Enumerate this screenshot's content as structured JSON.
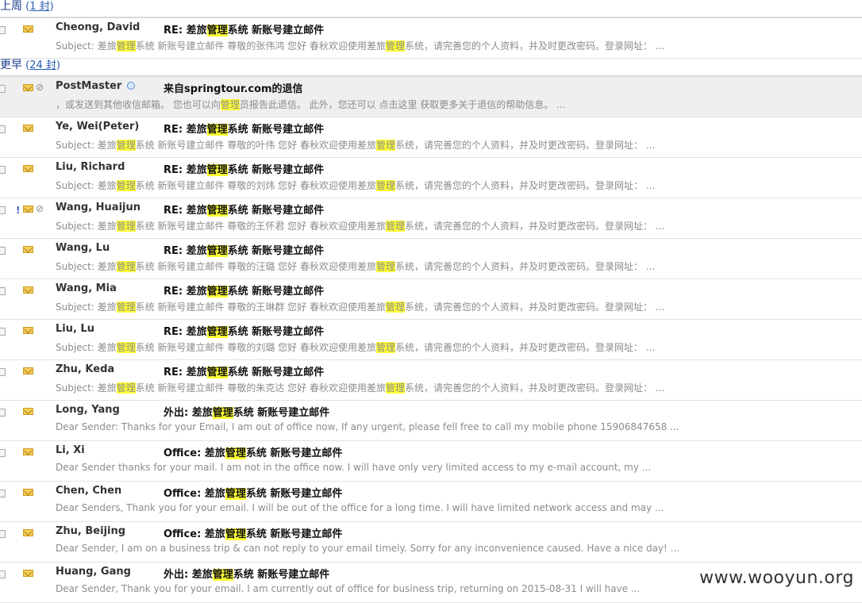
{
  "colors": {
    "highlight": "#ffff33",
    "link": "#2a5db0",
    "group": "#1a3f8b"
  },
  "groups": [
    {
      "label": "上周",
      "count_label": "1 封",
      "rows": [
        {
          "sender": "Cheong, David",
          "subject": "RE: 差旅|管理|系统 新账号建立邮件",
          "preview": "Subject: 差旅|管理|系统 新账号建立邮件 尊敬的张伟鸿 您好 春秋欢迎使用差旅|管理|系统，请完善您的个人资料，并及时更改密码。登录网址： ...",
          "icons": [
            "envelope-icon"
          ],
          "selected": false
        }
      ]
    },
    {
      "label": "更早",
      "count_label": "24 封",
      "rows": [
        {
          "sender": "PostMaster",
          "presence": true,
          "subject": "来自springtour.com的退信",
          "preview": "，或发送到其他收信邮箱。 您也可以向|管理|员报告此退信。 此外，您还可以 点击这里 获取更多关于退信的帮助信息。 ...",
          "icons": [
            "envelope-icon",
            "paperclip-icon"
          ],
          "selected": true
        },
        {
          "sender": "Ye, Wei(Peter)",
          "subject": "RE: 差旅|管理|系统 新账号建立邮件",
          "preview": "Subject: 差旅|管理|系统 新账号建立邮件 尊敬的叶伟 您好 春秋欢迎使用差旅|管理|系统，请完善您的个人资料，并及时更改密码。登录网址： ...",
          "icons": [
            "envelope-icon"
          ],
          "selected": false
        },
        {
          "sender": "Liu, Richard",
          "subject": "RE: 差旅|管理|系统 新账号建立邮件",
          "preview": "Subject: 差旅|管理|系统 新账号建立邮件 尊敬的刘炜 您好 春秋欢迎使用差旅|管理|系统，请完善您的个人资料，并及时更改密码。登录网址： ...",
          "icons": [
            "envelope-icon"
          ],
          "selected": false
        },
        {
          "sender": "Wang, Huaijun",
          "subject": "RE: 差旅|管理|系统 新账号建立邮件",
          "preview": "Subject: 差旅|管理|系统 新账号建立邮件 尊敬的王怀君 您好 春秋欢迎使用差旅|管理|系统，请完善您的个人资料，并及时更改密码。登录网址： ...",
          "icons": [
            "important-flag-icon",
            "envelope-icon",
            "paperclip-icon"
          ],
          "selected": false
        },
        {
          "sender": "Wang, Lu",
          "subject": "RE: 差旅|管理|系统 新账号建立邮件",
          "preview": "Subject: 差旅|管理|系统 新账号建立邮件 尊敬的汪璐 您好 春秋欢迎使用差旅|管理|系统，请完善您的个人资料，并及时更改密码。登录网址： ...",
          "icons": [
            "envelope-icon"
          ],
          "selected": false
        },
        {
          "sender": "Wang, Mia",
          "subject": "RE: 差旅|管理|系统 新账号建立邮件",
          "preview": "Subject: 差旅|管理|系统 新账号建立邮件 尊敬的王琳群 您好 春秋欢迎使用差旅|管理|系统，请完善您的个人资料，并及时更改密码。登录网址： ...",
          "icons": [
            "envelope-icon"
          ],
          "selected": false
        },
        {
          "sender": "Liu, Lu",
          "subject": "RE: 差旅|管理|系统 新账号建立邮件",
          "preview": "Subject: 差旅|管理|系统 新账号建立邮件 尊敬的刘璐 您好 春秋欢迎使用差旅|管理|系统，请完善您的个人资料，并及时更改密码。登录网址： ...",
          "icons": [
            "envelope-icon"
          ],
          "selected": false
        },
        {
          "sender": "Zhu, Keda",
          "subject": "RE: 差旅|管理|系统 新账号建立邮件",
          "preview": "Subject: 差旅|管理|系统 新账号建立邮件 尊敬的朱克达 您好 春秋欢迎使用差旅|管理|系统，请完善您的个人资料，并及时更改密码。登录网址： ...",
          "icons": [
            "envelope-icon"
          ],
          "selected": false
        },
        {
          "sender": "Long, Yang",
          "subject": "外出: 差旅|管理|系统 新账号建立邮件",
          "preview": "Dear Sender: Thanks for your Email, I am out of office now, If any urgent, please fell free to call my mobile phone 15906847658 ...",
          "icons": [
            "envelope-icon"
          ],
          "selected": false
        },
        {
          "sender": "Li, Xi",
          "subject": "Office: 差旅|管理|系统 新账号建立邮件",
          "preview": "Dear Sender thanks for your mail. I am not in the office now. I will have only very limited access to my e-mail account, my ...",
          "icons": [
            "envelope-icon"
          ],
          "selected": false
        },
        {
          "sender": "Chen, Chen",
          "subject": "Office: 差旅|管理|系统 新账号建立邮件",
          "preview": "Dear Senders, Thank you for your email. I will be out of the office for a long time. I will have limited network access and may ...",
          "icons": [
            "envelope-icon"
          ],
          "selected": false
        },
        {
          "sender": "Zhu, Beijing",
          "subject": "Office: 差旅|管理|系统 新账号建立邮件",
          "preview": "Dear Sender, I am on a business trip & can not reply to your email timely. Sorry for any inconvenience caused. Have a nice day! ...",
          "icons": [
            "envelope-icon"
          ],
          "selected": false
        },
        {
          "sender": "Huang, Gang",
          "subject": "外出: 差旅|管理|系统 新账号建立邮件",
          "preview": "Dear Sender, Thank you for your email. I am currently out of office for business trip, returning on 2015-08-31 I will have ...",
          "icons": [
            "envelope-icon"
          ],
          "selected": false
        }
      ]
    }
  ],
  "watermark": "www.wooyun.org"
}
